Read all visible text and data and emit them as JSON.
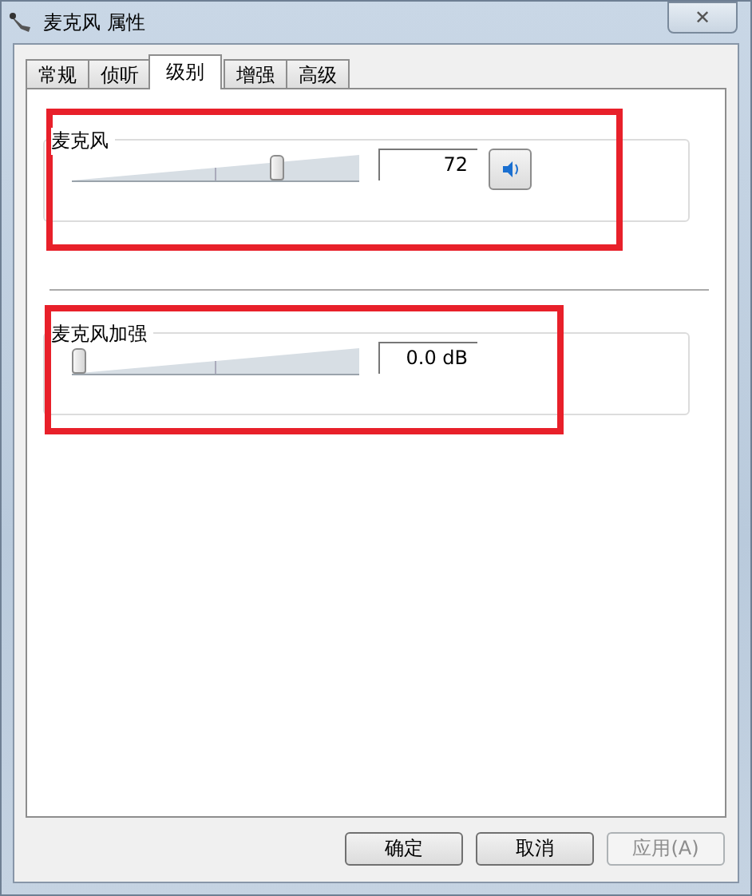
{
  "window": {
    "title": "麦克风 属性",
    "close": "✕"
  },
  "tabs": [
    {
      "label": "常规",
      "selected": false
    },
    {
      "label": "侦听",
      "selected": false
    },
    {
      "label": "级别",
      "selected": true
    },
    {
      "label": "增强",
      "selected": false
    },
    {
      "label": "高级",
      "selected": false
    }
  ],
  "groups": [
    {
      "label": "麦克风",
      "level": 0.72,
      "value": "72",
      "mute_button": true,
      "highlighted": true
    },
    {
      "label": "麦克风加强",
      "level": 0,
      "value": "0.0 dB",
      "highlighted": true
    }
  ],
  "buttons": [
    {
      "label": "确定",
      "disabled": false
    },
    {
      "label": "取消",
      "disabled": false
    },
    {
      "label": "应用(A)",
      "disabled": true
    }
  ]
}
